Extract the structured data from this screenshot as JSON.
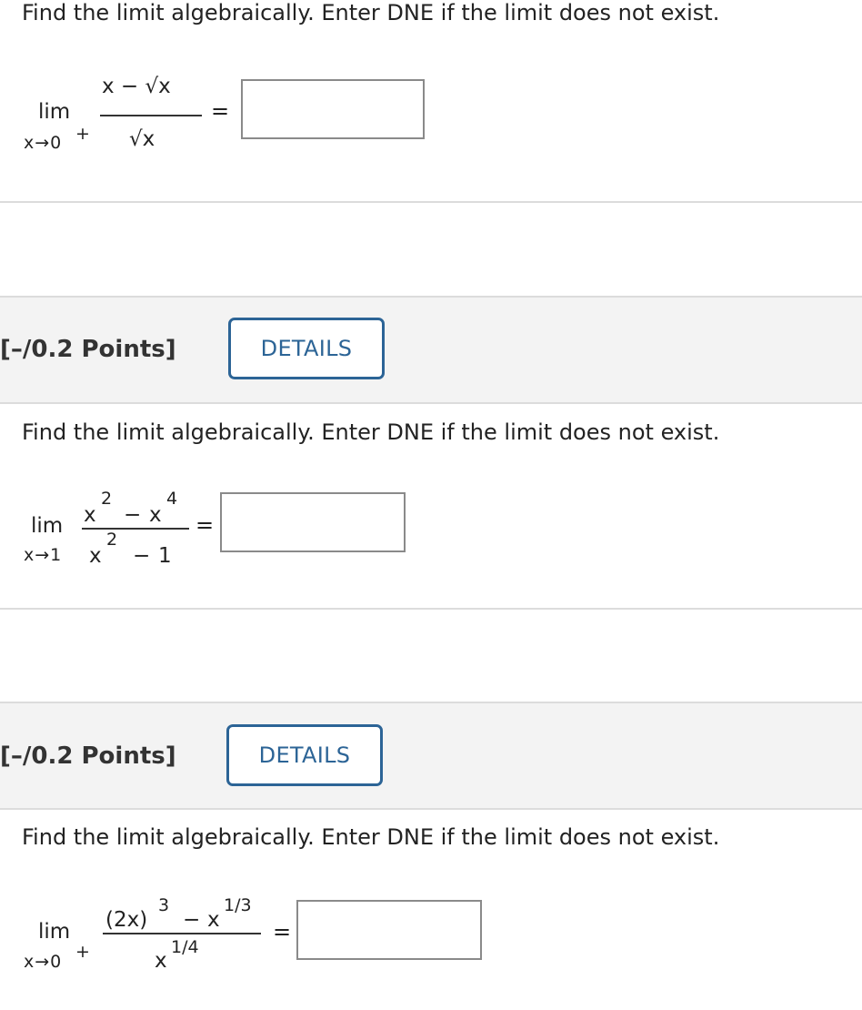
{
  "problems": [
    {
      "prompt": "Find the limit algebraically. Enter DNE if the limit does not exist.",
      "limit_word": "lim",
      "subscript": "x→0",
      "subscript_sup": "+",
      "numerator": "x − √x",
      "denominator": "√x",
      "equals": "=",
      "answer": ""
    },
    {
      "points": "[–/0.2 Points]",
      "details_label": "DETAILS",
      "prompt": "Find the limit algebraically. Enter DNE if the limit does not exist.",
      "limit_word": "lim",
      "subscript": "x→1",
      "numerator": {
        "a": "x",
        "a_exp": "2",
        "op": "−",
        "b": "x",
        "b_exp": "4"
      },
      "denominator": {
        "a": "x",
        "a_exp": "2",
        "op": "−",
        "b": "1"
      },
      "equals": "=",
      "answer": ""
    },
    {
      "points": "[–/0.2 Points]",
      "details_label": "DETAILS",
      "prompt": "Find the limit algebraically. Enter DNE if the limit does not exist.",
      "limit_word": "lim",
      "subscript": "x→0",
      "subscript_sup": "+",
      "numerator": {
        "a": "(2x)",
        "a_exp": "3",
        "op": "−",
        "b": "x",
        "b_exp": "1/3"
      },
      "denominator": {
        "a": "x",
        "a_exp": "1/4"
      },
      "equals": "=",
      "answer": ""
    }
  ]
}
